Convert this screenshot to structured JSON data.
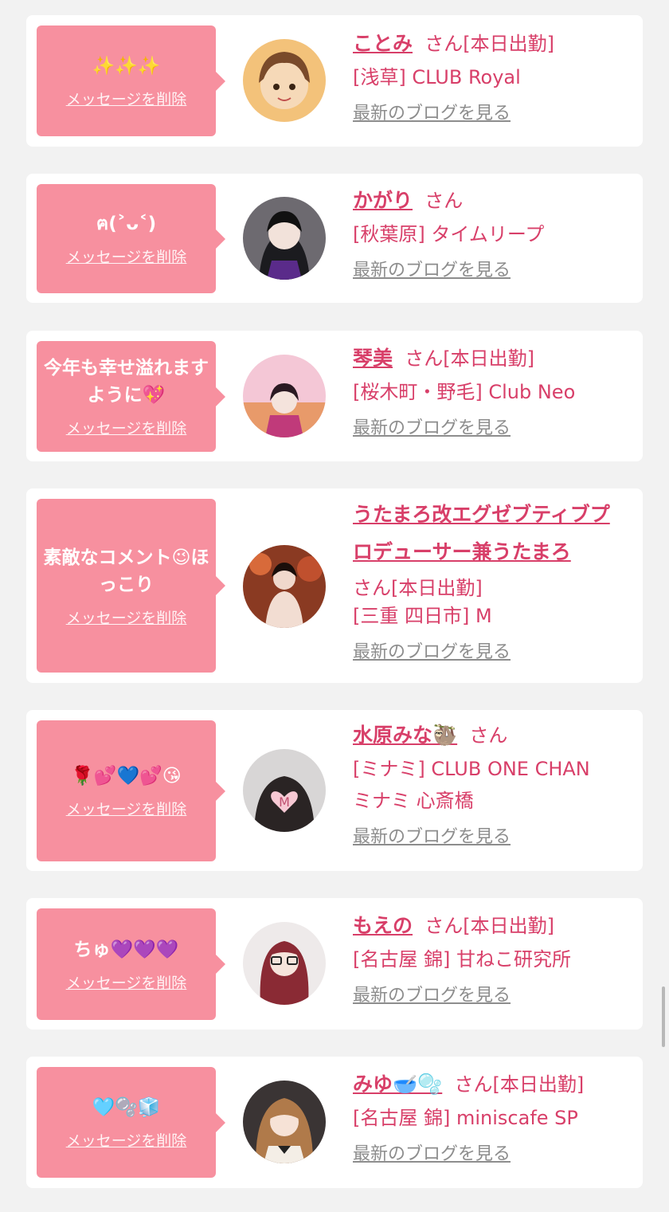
{
  "delete_label": "メッセージを削除",
  "blog_label": "最新のブログを見る",
  "entries": [
    {
      "message": "✨✨✨",
      "name": "ことみ",
      "suffix": "さん[本日出勤]",
      "shop": "[浅草] CLUB Royal",
      "shop2": ""
    },
    {
      "message": "ฅ(˃ᴗ˂)",
      "name": "かがり",
      "suffix": "さん",
      "shop": "[秋葉原] タイムリープ",
      "shop2": ""
    },
    {
      "message": "今年も幸せ溢れますように💖",
      "name": "琴美",
      "suffix": "さん[本日出勤]",
      "shop": "[桜木町・野毛] Club Neo",
      "shop2": ""
    },
    {
      "message": "素敵なコメント😉ほっこり",
      "name": "うたまろ改エグゼブティブプロデューサー兼うたまろ",
      "suffix": "さん[本日出勤]",
      "shop": "[三重 四日市] M",
      "shop2": ""
    },
    {
      "message": "🌹💕💙💕😘",
      "name": "水原みな🦥",
      "suffix": "さん",
      "shop": "[ミナミ] CLUB ONE CHAN",
      "shop2": "ミナミ 心斎橋"
    },
    {
      "message": "ちゅ💜💜💜",
      "name": "もえの",
      "suffix": "さん[本日出勤]",
      "shop": "[名古屋 錦] 甘ねこ研究所",
      "shop2": ""
    },
    {
      "message": "🩵🫧🧊",
      "name": "みゆ🥣🫧",
      "suffix": "さん[本日出勤]",
      "shop": "[名古屋 錦] miniscafe SP",
      "shop2": ""
    }
  ],
  "colors": {
    "accent": "#d83f69",
    "bubble": "#f7909f",
    "background": "#f2f2f2"
  }
}
